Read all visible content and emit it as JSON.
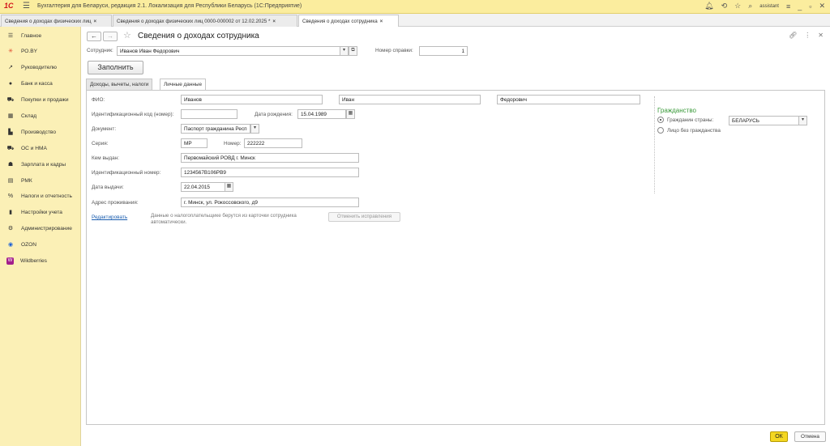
{
  "app": {
    "logo": "1С",
    "title": "Бухгалтерия для Беларуси, редакция 2.1. Локализация для Республики Беларусь   (1С:Предприятие)",
    "user": "assistant"
  },
  "tabs": [
    {
      "label": "Сведения о доходах физических лиц"
    },
    {
      "label": "Сведения о доходах физических лиц 0000-000002 от 12.02.2025 *"
    },
    {
      "label": "Сведения о доходах сотрудника"
    }
  ],
  "sidebar": {
    "items": [
      {
        "label": "Главное"
      },
      {
        "label": "РО.BY"
      },
      {
        "label": "Руководителю"
      },
      {
        "label": "Банк и касса"
      },
      {
        "label": "Покупки и продажи"
      },
      {
        "label": "Склад"
      },
      {
        "label": "Производство"
      },
      {
        "label": "ОС и НМА"
      },
      {
        "label": "Зарплата и кадры"
      },
      {
        "label": "РМК"
      },
      {
        "label": "Налоги и отчетность"
      },
      {
        "label": "Настройки учета"
      },
      {
        "label": "Администрирование"
      },
      {
        "label": "OZON"
      },
      {
        "label": "Wildberries"
      }
    ]
  },
  "form": {
    "title": "Сведения о доходах сотрудника",
    "employee_label": "Сотрудник:",
    "employee_value": "Иванов Иван Федорович",
    "cert_number_label": "Номер справки:",
    "cert_number_value": "1",
    "fill_button": "Заполнить",
    "tab_income": "Доходы, вычеты, налоги",
    "tab_personal": "Личные данные"
  },
  "personal": {
    "fio_label": "ФИО:",
    "last_name": "Иванов",
    "first_name": "Иван",
    "middle_name": "Федорович",
    "id_code_label": "Идентификационный код (номер):",
    "id_code_value": "",
    "birth_label": "Дата рождения:",
    "birth_value": "15.04.1989",
    "doc_label": "Документ:",
    "doc_value": "Паспорт гражданина Респ",
    "series_label": "Серия:",
    "series_value": "MP",
    "number_label": "Номер:",
    "number_value": "222222",
    "issued_by_label": "Кем выдан:",
    "issued_by_value": "Первомайский РОВД г. Минск",
    "ident_label": "Идентификационный номер:",
    "ident_value": "1234567В106РВ9",
    "issue_date_label": "Дата выдачи:",
    "issue_date_value": "22.04.2015",
    "address_label": "Адрес проживания:",
    "address_value": "г. Минск, ул. Рокоссовского, д9",
    "edit_link": "Редактировать",
    "note": "Данные о налогоплательщике берутся из карточки сотрудника автоматически.",
    "revert_button": "Отменить исправления"
  },
  "citizenship": {
    "title": "Гражданство",
    "citizen_label": "Гражданин страны:",
    "country_value": "БЕЛАРУСЬ",
    "stateless_label": "Лицо без гражданства"
  },
  "footer": {
    "ok": "ОК",
    "cancel": "Отмена"
  }
}
